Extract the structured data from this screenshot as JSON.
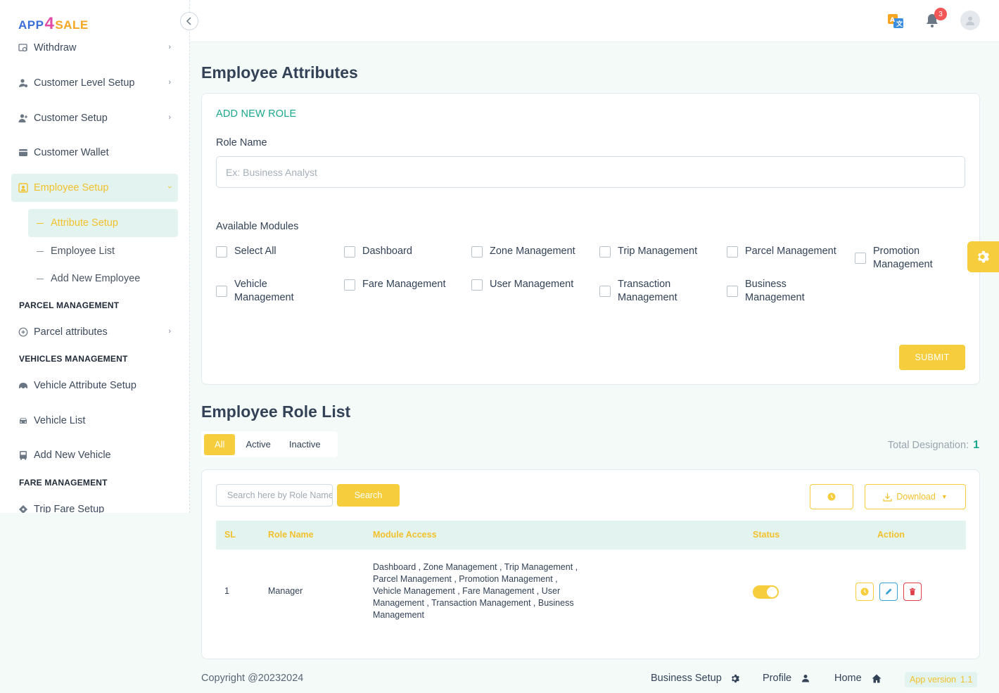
{
  "brand": {
    "part1": "APP",
    "part2": "4",
    "part3": "SALE"
  },
  "sidebar": {
    "items": [
      {
        "label": "Withdraw"
      },
      {
        "label": "Customer Level Setup"
      },
      {
        "label": "Customer Setup"
      },
      {
        "label": "Customer Wallet"
      },
      {
        "label": "Employee Setup"
      }
    ],
    "employee_sub": [
      {
        "label": "Attribute Setup"
      },
      {
        "label": "Employee List"
      },
      {
        "label": "Add New Employee"
      }
    ],
    "parcel_section": "PARCEL MANAGEMENT",
    "parcel_items": [
      {
        "label": "Parcel attributes"
      }
    ],
    "vehicles_section": "VEHICLES MANAGEMENT",
    "vehicle_items": [
      {
        "label": "Vehicle Attribute Setup"
      },
      {
        "label": "Vehicle List"
      },
      {
        "label": "Add New Vehicle"
      }
    ],
    "fare_section": "FARE MANAGEMENT",
    "fare_items": [
      {
        "label": "Trip Fare Setup"
      }
    ]
  },
  "topbar": {
    "notification_count": "3"
  },
  "page": {
    "title": "Employee Attributes"
  },
  "form": {
    "heading": "ADD NEW ROLE",
    "role_name_label": "Role Name",
    "role_name_placeholder": "Ex: Business Analyst",
    "modules_label": "Available Modules",
    "modules": [
      "Select All",
      "Dashboard",
      "Zone Management",
      "Trip Management",
      "Parcel Management",
      "Promotion Management",
      "Vehicle Management",
      "Fare Management",
      "User Management",
      "Transaction Management",
      "Business Management"
    ],
    "submit": "SUBMIT"
  },
  "role_list": {
    "title": "Employee Role List",
    "tabs": [
      "All",
      "Active",
      "Inactive"
    ],
    "total_label": "Total Designation:",
    "total_value": "1",
    "search_placeholder": "Search here by Role Name",
    "search_button": "Search",
    "download": "Download",
    "columns": [
      "SL",
      "Role Name",
      "Module Access",
      "Status",
      "Action"
    ],
    "rows": [
      {
        "sl": "1",
        "role_name": "Manager",
        "module_access": "Dashboard , Zone Management , Trip Management , Parcel Management , Promotion Management , Vehicle Management , Fare Management , User Management , Transaction Management , Business Management",
        "status_on": true
      }
    ]
  },
  "footer": {
    "copyright": "Copyright @20232024",
    "links": [
      "Business Setup",
      "Profile",
      "Home"
    ],
    "version_label": "App version",
    "version_value": "1.1"
  },
  "colors": {
    "accent": "#f6cd3d",
    "teal": "#1aa68a",
    "mint": "#e3f3ef"
  }
}
